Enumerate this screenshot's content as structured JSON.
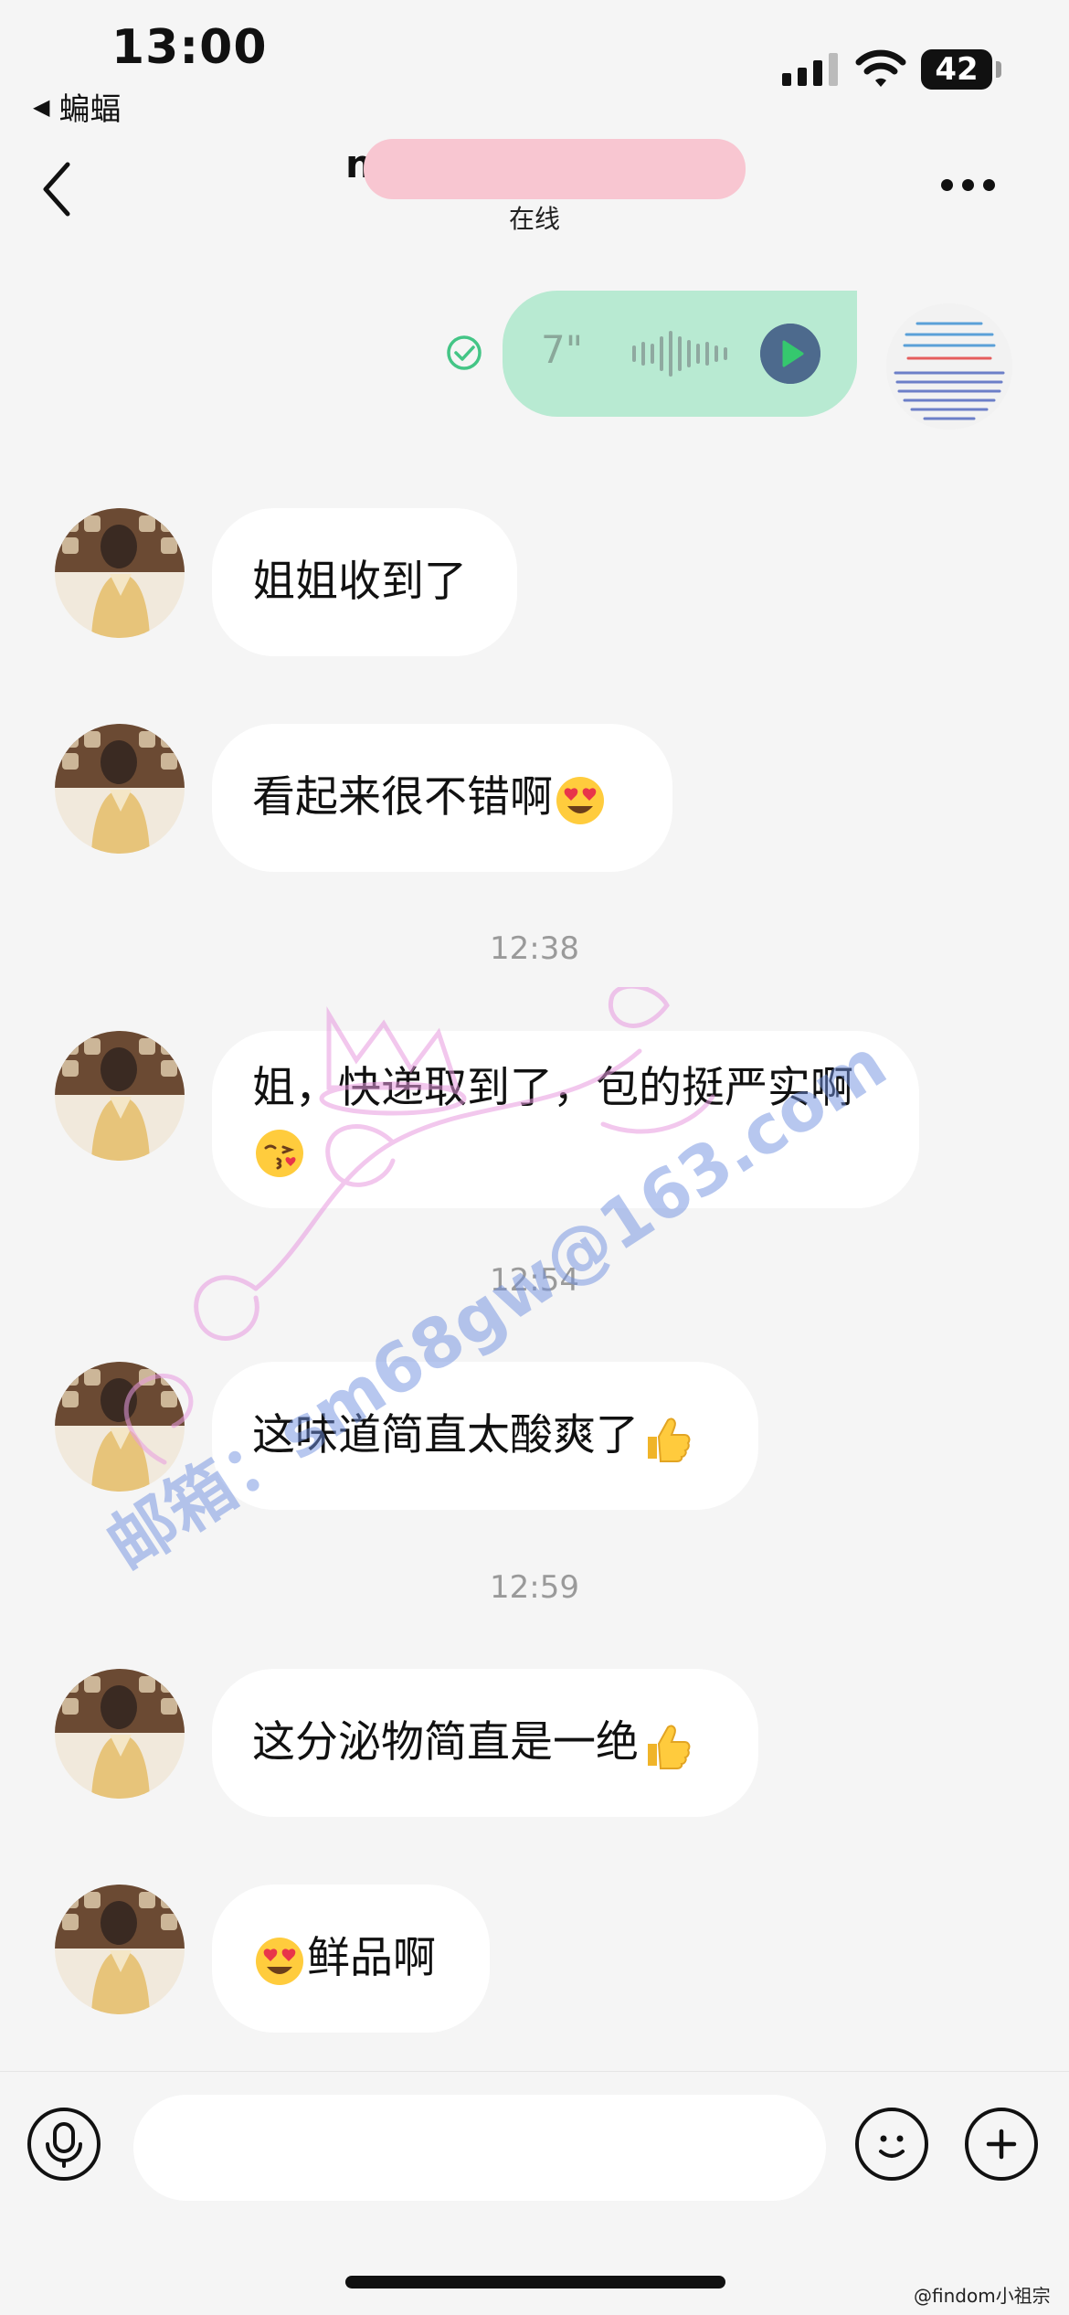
{
  "status_bar": {
    "time": "13:00",
    "back_app": "蝙蝠",
    "battery": "42"
  },
  "header": {
    "title": "n",
    "status": "在线"
  },
  "voice_message": {
    "duration": "7\""
  },
  "messages": [
    {
      "text": "姐姐收到了",
      "emoji_before": "",
      "emoji_after": ""
    },
    {
      "text": "看起来很不错啊",
      "emoji_before": "",
      "emoji_after": "heart-eyes"
    },
    {
      "text": "姐，快递取到了，包的挺严实啊",
      "emoji_before": "",
      "emoji_after": "kiss"
    },
    {
      "text": "这味道简直太酸爽了",
      "emoji_before": "",
      "emoji_after": "thumbs-up"
    },
    {
      "text": "这分泌物简直是一绝",
      "emoji_before": "",
      "emoji_after": "thumbs-up"
    },
    {
      "text": "鲜品啊",
      "emoji_before": "heart-eyes",
      "emoji_after": ""
    }
  ],
  "timestamps": [
    "12:38",
    "12:54",
    "12:59"
  ],
  "watermark": "邮箱：sm68gw@163.com",
  "input": {
    "placeholder": ""
  },
  "credit": "@findom小祖宗",
  "colors": {
    "background": "#f5f5f5",
    "voice_bubble": "#b8ead2",
    "play_button": "#4d6a8d",
    "play_icon": "#35c86e",
    "name_redaction": "#f8c6d1"
  }
}
